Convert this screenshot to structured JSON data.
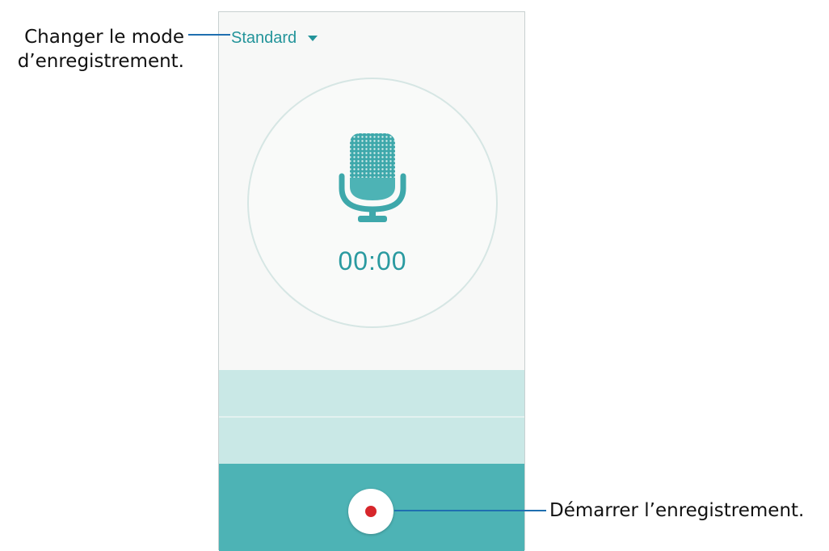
{
  "recorder": {
    "mode_label": "Standard",
    "timer": "00:00"
  },
  "callouts": {
    "mode_line1": "Changer le mode",
    "mode_line2": "d’enregistrement.",
    "record": "Démarrer l’enregistrement."
  },
  "colors": {
    "accent": "#4db3b5",
    "band": "#c9e8e6",
    "record": "#d7262b",
    "callout_line": "#1f6fb0"
  },
  "icons": [
    "dropdown-caret-icon",
    "microphone-icon",
    "record-icon"
  ]
}
